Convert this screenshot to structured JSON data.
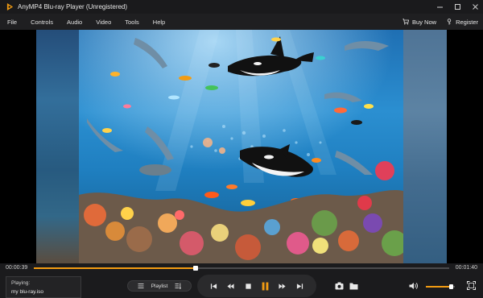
{
  "window": {
    "title": "AnyMP4 Blu-ray Player (Unregistered)",
    "accent_color": "#f39c12",
    "controls": [
      "minimize-icon",
      "maximize-icon",
      "close-icon"
    ]
  },
  "menu": {
    "items": [
      "File",
      "Controls",
      "Audio",
      "Video",
      "Tools",
      "Help"
    ],
    "buy_now": "Buy Now",
    "register": "Register"
  },
  "video": {
    "content": "underwater coral reef scene with orcas, dolphins, turtles and tropical fish"
  },
  "playback": {
    "current_time": "00:00:39",
    "total_time": "00:01:40",
    "progress_fraction": 0.39,
    "volume_fraction": 0.85
  },
  "now_playing": {
    "label": "Playing:",
    "file": "my blu-ray.iso"
  },
  "playlist": {
    "label": "Playlist"
  },
  "transport_icons": [
    "skip-previous-icon",
    "rewind-icon",
    "stop-icon",
    "pause-icon",
    "fast-forward-icon",
    "skip-next-icon"
  ],
  "tool_icons": [
    "snapshot-icon",
    "open-folder-icon"
  ],
  "right_icons": [
    "volume-icon",
    "fullscreen-icon"
  ]
}
